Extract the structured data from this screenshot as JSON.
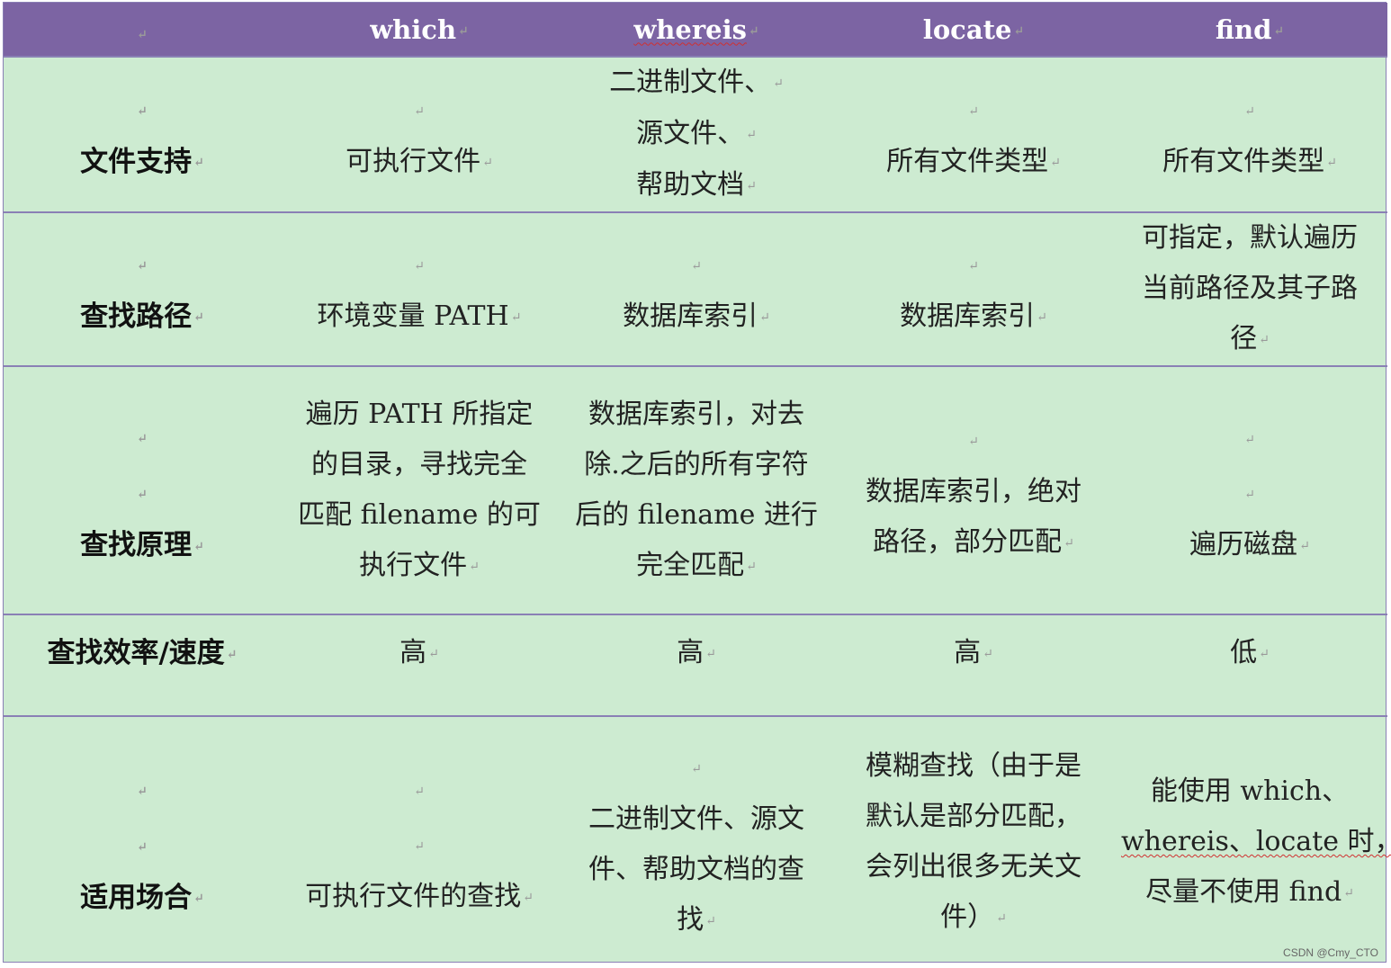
{
  "paragraph_mark": "↵",
  "header": {
    "corner": "",
    "cols": [
      "which",
      "whereis",
      "locate",
      "find"
    ]
  },
  "rows": [
    {
      "label": "文件支持",
      "cells": [
        {
          "lines": [
            "",
            "可执行文件"
          ]
        },
        {
          "lines": [
            "二进制文件、",
            "源文件、",
            "帮助文档"
          ]
        },
        {
          "lines": [
            "",
            "所有文件类型"
          ]
        },
        {
          "lines": [
            "",
            "所有文件类型"
          ]
        }
      ]
    },
    {
      "label": "查找路径",
      "cells": [
        {
          "lines": [
            "",
            "环境变量 PATH"
          ]
        },
        {
          "lines": [
            "",
            "数据库索引"
          ]
        },
        {
          "lines": [
            "",
            "数据库索引"
          ]
        },
        {
          "lines": [
            "可指定，默认遍历",
            "当前路径及其子路",
            "径"
          ]
        }
      ]
    },
    {
      "label": "查找原理",
      "cells": [
        {
          "lines": [
            "遍历 PATH 所指定",
            "的目录，寻找完全",
            "匹配 filename 的可",
            "执行文件"
          ]
        },
        {
          "lines": [
            "数据库索引，对去",
            "除.之后的所有字符",
            "后的 filename 进行",
            "完全匹配"
          ]
        },
        {
          "lines": [
            "",
            "数据库索引，绝对",
            "路径，部分匹配"
          ]
        },
        {
          "lines": [
            "",
            "",
            "遍历磁盘"
          ]
        }
      ]
    },
    {
      "label": "查找效率/速度",
      "cells": [
        {
          "lines": [
            "高"
          ]
        },
        {
          "lines": [
            "高"
          ]
        },
        {
          "lines": [
            "高"
          ]
        },
        {
          "lines": [
            "低"
          ]
        }
      ]
    },
    {
      "label": "适用场合",
      "cells": [
        {
          "lines": [
            "",
            "",
            "可执行文件的查找"
          ]
        },
        {
          "lines": [
            "",
            "二进制文件、源文",
            "件、帮助文档的查",
            "找"
          ]
        },
        {
          "lines": [
            "模糊查找（由于是",
            "默认是部分匹配，",
            "会列出很多无关文",
            "件）"
          ]
        },
        {
          "lines": [
            "能使用 which、",
            "whereis、locate 时，",
            "尽量不使用 find"
          ]
        }
      ]
    }
  ],
  "watermark": "CSDN @Cmy_CTO"
}
